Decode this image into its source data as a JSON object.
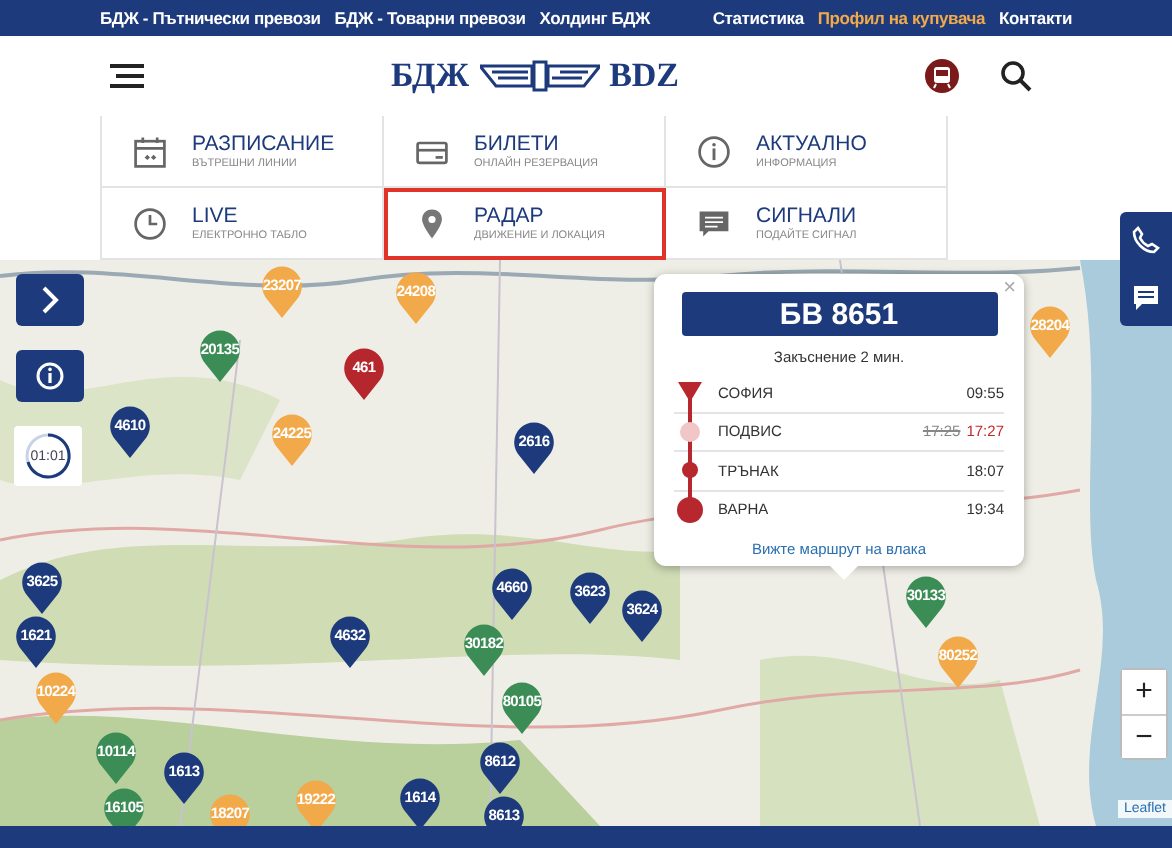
{
  "top_bar": {
    "left_links": [
      {
        "label": "БДЖ - Пътнически превози",
        "highlighted": false
      },
      {
        "label": "БДЖ - Товарни превози",
        "highlighted": false
      },
      {
        "label": "Холдинг БДЖ",
        "highlighted": false
      }
    ],
    "right_links": [
      {
        "label": "Статистика",
        "highlighted": false
      },
      {
        "label": "Профил на купувача",
        "highlighted": true
      },
      {
        "label": "Контакти",
        "highlighted": false
      }
    ]
  },
  "header": {
    "logo_left": "БДЖ",
    "logo_right": "BDZ"
  },
  "menu": [
    {
      "title": "РАЗПИСАНИЕ",
      "subtitle": "ВЪТРЕШНИ ЛИНИИ",
      "selected": false
    },
    {
      "title": "БИЛЕТИ",
      "subtitle": "ОНЛАЙН РЕЗЕРВАЦИЯ",
      "selected": false
    },
    {
      "title": "АКТУАЛНО",
      "subtitle": "ИНФОРМАЦИЯ",
      "selected": false
    },
    {
      "title": "LIVE",
      "subtitle": "ЕЛЕКТРОННО ТАБЛО",
      "selected": false
    },
    {
      "title": "РАДАР",
      "subtitle": "ДВИЖЕНИЕ И ЛОКАЦИЯ",
      "selected": true
    },
    {
      "title": "СИГНАЛИ",
      "subtitle": "ПОДАЙТЕ СИГНАЛ",
      "selected": false
    }
  ],
  "map": {
    "timer": "01:01",
    "markers": [
      {
        "label": "23207",
        "color": "#f2a94a"
      },
      {
        "label": "24208",
        "color": "#f2a94a"
      },
      {
        "label": "20135",
        "color": "#3b8d55"
      },
      {
        "label": "461",
        "color": "#b5272d"
      },
      {
        "label": "4610",
        "color": "#1d3a7c"
      },
      {
        "label": "24225",
        "color": "#f2a94a"
      },
      {
        "label": "2616",
        "color": "#1d3a7c"
      },
      {
        "label": "28204",
        "color": "#f2a94a"
      },
      {
        "label": "3625",
        "color": "#1d3a7c"
      },
      {
        "label": "1621",
        "color": "#1d3a7c"
      },
      {
        "label": "10224",
        "color": "#f2a94a"
      },
      {
        "label": "4632",
        "color": "#1d3a7c"
      },
      {
        "label": "4660",
        "color": "#1d3a7c"
      },
      {
        "label": "30182",
        "color": "#3b8d55"
      },
      {
        "label": "3623",
        "color": "#1d3a7c"
      },
      {
        "label": "3624",
        "color": "#1d3a7c"
      },
      {
        "label": "80105",
        "color": "#3b8d55"
      },
      {
        "label": "30133",
        "color": "#3b8d55"
      },
      {
        "label": "80252",
        "color": "#f2a94a"
      },
      {
        "label": "10114",
        "color": "#3b8d55"
      },
      {
        "label": "1613",
        "color": "#1d3a7c"
      },
      {
        "label": "16105",
        "color": "#3b8d55"
      },
      {
        "label": "18207",
        "color": "#f2a94a"
      },
      {
        "label": "19222",
        "color": "#f2a94a"
      },
      {
        "label": "1614",
        "color": "#1d3a7c"
      },
      {
        "label": "8612",
        "color": "#1d3a7c"
      },
      {
        "label": "8613",
        "color": "#1d3a7c"
      }
    ],
    "zoom_in": "+",
    "zoom_out": "−",
    "attribution": "Leaflet",
    "popup": {
      "close": "×",
      "train": "БВ 8651",
      "delay": "Закъснение 2 мин.",
      "stops": [
        {
          "kind": "start",
          "name": "СОФИЯ",
          "time": "09:55"
        },
        {
          "kind": "passed",
          "name": "ПОДВИС",
          "scheduled": "17:25",
          "time": "17:27"
        },
        {
          "kind": "stop",
          "name": "ТРЪНАК",
          "time": "18:07"
        },
        {
          "kind": "end",
          "name": "ВАРНА",
          "time": "19:34"
        }
      ],
      "link": "Вижте маршрут на влака"
    }
  }
}
